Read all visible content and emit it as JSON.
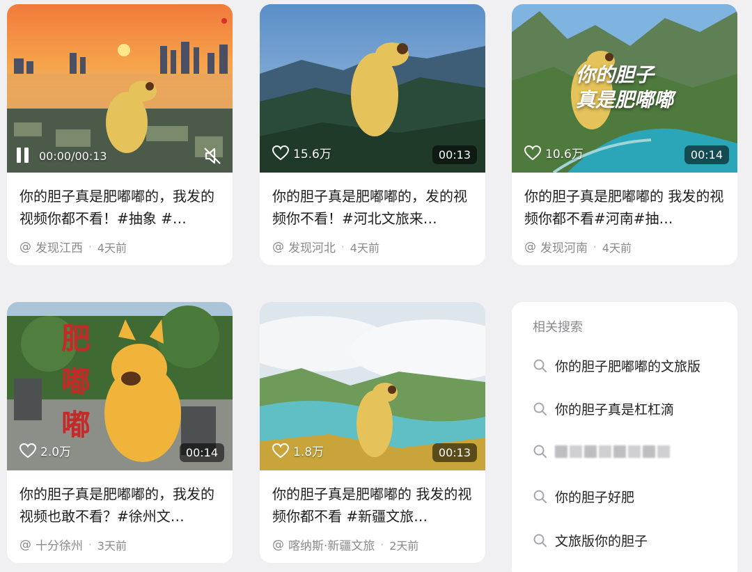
{
  "cards": [
    {
      "title": "你的胆子真是肥嘟嘟的，我发的视频你都不看！#抽象 #…",
      "author": "发现江西",
      "time": "4天前",
      "player_time": "00:00/00:13"
    },
    {
      "title": "你的胆子真是肥嘟嘟的，发的视频你不看！#河北文旅来…",
      "author": "发现河北",
      "time": "4天前",
      "likes": "15.6万",
      "duration": "00:13"
    },
    {
      "title": "你的胆子真是肥嘟嘟的 我发的视频你都不看#河南#抽…",
      "author": "发现河南",
      "time": "4天前",
      "likes": "10.6万",
      "duration": "00:14",
      "overlay_text": [
        "你的胆子",
        "真是肥嘟嘟"
      ]
    },
    {
      "title": "你的胆子真是肥嘟嘟的，我发的视频也敢不看？#徐州文…",
      "author": "十分徐州",
      "time": "3天前",
      "likes": "2.0万",
      "duration": "00:14",
      "overlay_text": [
        "肥",
        "嘟",
        "嘟"
      ]
    },
    {
      "title": "你的胆子真是肥嘟嘟的 我发的视频你都不看 #新疆文旅…",
      "author": "喀纳斯·新疆文旅",
      "time": "2天前",
      "likes": "1.8万",
      "duration": "00:13"
    }
  ],
  "related": {
    "title": "相关搜索",
    "items": [
      "你的胆子肥嘟嘟的文旅版",
      "你的胆子真是杠杠滴",
      "你的胆子好肥",
      "文旅版你的胆子"
    ]
  },
  "colors": {
    "accent_text": "#1d1d1f",
    "muted": "#8a8a8e",
    "page_bg": "#f0f0f2"
  }
}
